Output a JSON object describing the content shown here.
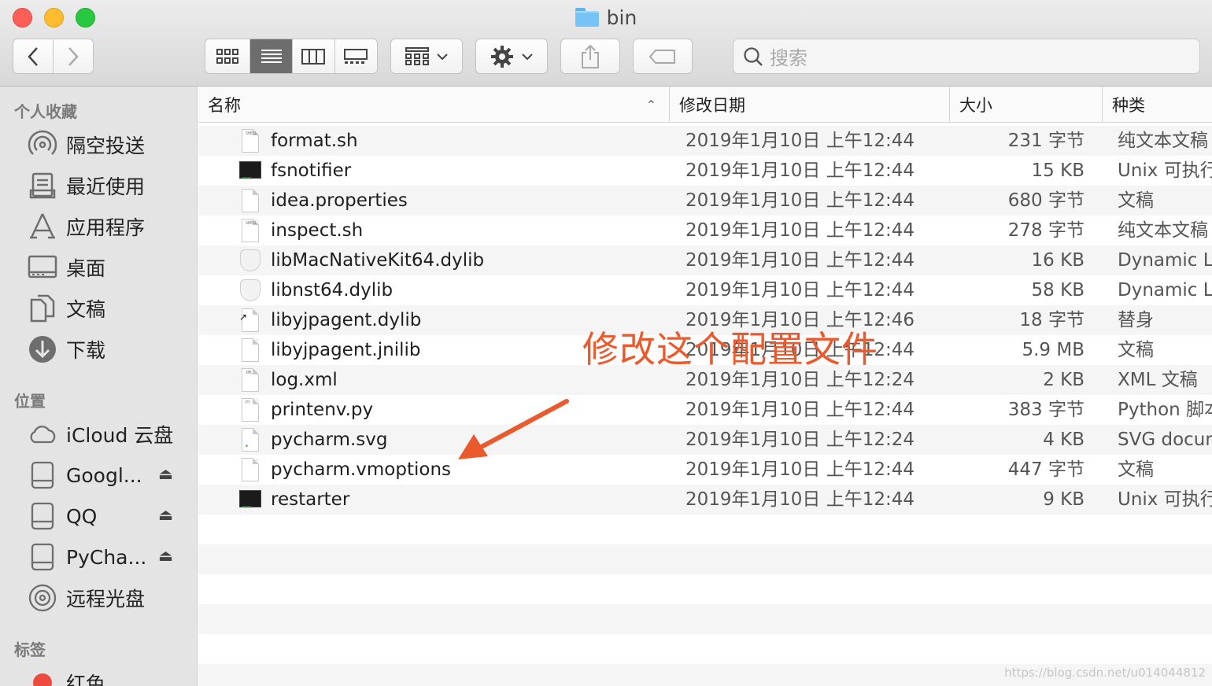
{
  "window": {
    "title": "bin"
  },
  "toolbar": {
    "search_placeholder": "搜索"
  },
  "sidebar": {
    "favorites_header": "个人收藏",
    "favorites": [
      {
        "label": "隔空投送",
        "icon": "airdrop-icon"
      },
      {
        "label": "最近使用",
        "icon": "recents-icon"
      },
      {
        "label": "应用程序",
        "icon": "applications-icon"
      },
      {
        "label": "桌面",
        "icon": "desktop-icon"
      },
      {
        "label": "文稿",
        "icon": "documents-icon"
      },
      {
        "label": "下载",
        "icon": "downloads-icon"
      }
    ],
    "locations_header": "位置",
    "locations": [
      {
        "label": "iCloud 云盘",
        "icon": "icloud-icon",
        "eject": false
      },
      {
        "label": "Googl...",
        "icon": "drive-icon",
        "eject": true
      },
      {
        "label": "QQ",
        "icon": "drive-icon",
        "eject": true
      },
      {
        "label": "PyCha...",
        "icon": "drive-icon",
        "eject": true
      },
      {
        "label": "远程光盘",
        "icon": "optical-disc-icon",
        "eject": false
      }
    ],
    "tags_header": "标签",
    "tags": [
      {
        "label": "红色",
        "color": "#ee4b3f"
      }
    ]
  },
  "list": {
    "columns": {
      "name": "名称",
      "date": "修改日期",
      "size": "大小",
      "kind": "种类"
    },
    "files": [
      {
        "name": "format.sh",
        "date": "2019年1月10日 上午12:44",
        "size": "231 字节",
        "kind": "纯文本文稿",
        "icon": "script"
      },
      {
        "name": "fsnotifier",
        "date": "2019年1月10日 上午12:44",
        "size": "15 KB",
        "kind": "Unix 可执行",
        "icon": "terminal"
      },
      {
        "name": "idea.properties",
        "date": "2019年1月10日 上午12:44",
        "size": "680 字节",
        "kind": "文稿",
        "icon": "document"
      },
      {
        "name": "inspect.sh",
        "date": "2019年1月10日 上午12:44",
        "size": "278 字节",
        "kind": "纯文本文稿",
        "icon": "script"
      },
      {
        "name": "libMacNativeKit64.dylib",
        "date": "2019年1月10日 上午12:44",
        "size": "16 KB",
        "kind": "Dynamic L",
        "icon": "library"
      },
      {
        "name": "libnst64.dylib",
        "date": "2019年1月10日 上午12:44",
        "size": "58 KB",
        "kind": "Dynamic L",
        "icon": "library"
      },
      {
        "name": "libyjpagent.dylib",
        "date": "2019年1月10日 上午12:46",
        "size": "18 字节",
        "kind": "替身",
        "icon": "alias"
      },
      {
        "name": "libyjpagent.jnilib",
        "date": "2019年1月10日 上午12:44",
        "size": "5.9 MB",
        "kind": "文稿",
        "icon": "document"
      },
      {
        "name": "log.xml",
        "date": "2019年1月10日 上午12:24",
        "size": "2 KB",
        "kind": "XML 文稿",
        "icon": "xml"
      },
      {
        "name": "printenv.py",
        "date": "2019年1月10日 上午12:44",
        "size": "383 字节",
        "kind": "Python 脚本",
        "icon": "script"
      },
      {
        "name": "pycharm.svg",
        "date": "2019年1月10日 上午12:24",
        "size": "4 KB",
        "kind": "SVG docum",
        "icon": "svg"
      },
      {
        "name": "pycharm.vmoptions",
        "date": "2019年1月10日 上午12:44",
        "size": "447 字节",
        "kind": "文稿",
        "icon": "document"
      },
      {
        "name": "restarter",
        "date": "2019年1月10日 上午12:44",
        "size": "9 KB",
        "kind": "Unix 可执行",
        "icon": "terminal"
      }
    ]
  },
  "annotation": {
    "text": "修改这个配置文件",
    "color": "#ea5a2c"
  },
  "watermark": "https://blog.csdn.net/u014044812"
}
